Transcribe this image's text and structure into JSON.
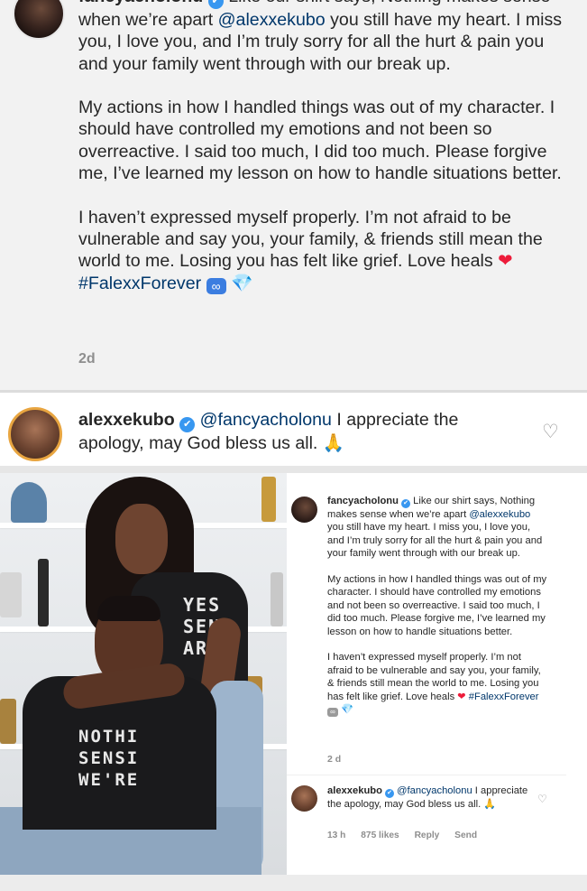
{
  "top_post": {
    "username": "fancyacholonu",
    "verified_glyph": "✔",
    "p1_text": "Like our shirt says, Nothing makes sense when we’re apart ",
    "p1_mention": "@alexxekubo",
    "p1_rest": " you still have my heart. I miss you, I love you, and I’m truly sorry for all the hurt & pain you and your family went through with our break up.",
    "p2": "My actions in how I handled things was out of my character. I should have controlled my emotions and not been so overreactive. I said too much, I did too much. Please forgive me, I’ve learned my lesson on how to handle situations better.",
    "p3": "I haven’t expressed myself properly. I’m not afraid to be vulnerable and say you, your family, & friends still mean the world to me. Losing you has felt like grief. Love heals ",
    "heart_glyph": "❤",
    "hashtag": "#FalexxForever",
    "infinity_glyph": "∞",
    "gem_glyph": "💎",
    "time": "2d"
  },
  "reply": {
    "username": "alexxekubo",
    "mention": "@fancyacholonu",
    "text": " I appreciate the apology, may God bless us all. ",
    "pray_glyph": "🙏",
    "heart_outline_glyph": "♡"
  },
  "photo": {
    "shirt_line1_her": "YES",
    "shirt_line2_her": "SEN",
    "shirt_line3_her": "ART",
    "shirt_line1_his": "NOTHI",
    "shirt_line2_his": "SENSI",
    "shirt_line3_his": "WE'RE"
  },
  "card": {
    "username": "fancyacholonu",
    "p1_text": "Like our shirt says, Nothing makes sense when we’re apart ",
    "p1_mention": "@alexxekubo",
    "p1_rest": " you still have my heart. I miss you, I love you, and I’m truly sorry for all the hurt & pain you and your family went through with our break up.",
    "p2": "My actions in how I handled things was out of my character. I should have controlled my emotions and not been so overreactive. I said too much, I did too much. Please forgive me, I’ve learned my lesson on how to handle situations better.",
    "p3": "I haven’t expressed myself properly. I’m not afraid to be vulnerable and say you, your family, & friends still mean the world to me. Losing you has felt like grief. Love heals ",
    "hashtag": "#FalexxForever",
    "time": "2 d",
    "reply_username": "alexxekubo",
    "reply_mention": "@fancyacholonu",
    "reply_text": " I appreciate the apology, may God bless us all. ",
    "reply_time": "13 h",
    "reply_likes": "875 likes",
    "reply_label": "Reply",
    "send_label": "Send"
  },
  "colors": {
    "verified": "#3897f0",
    "mention": "#00376b",
    "heart": "#ed1c3a",
    "muted": "#8e8e8e"
  }
}
